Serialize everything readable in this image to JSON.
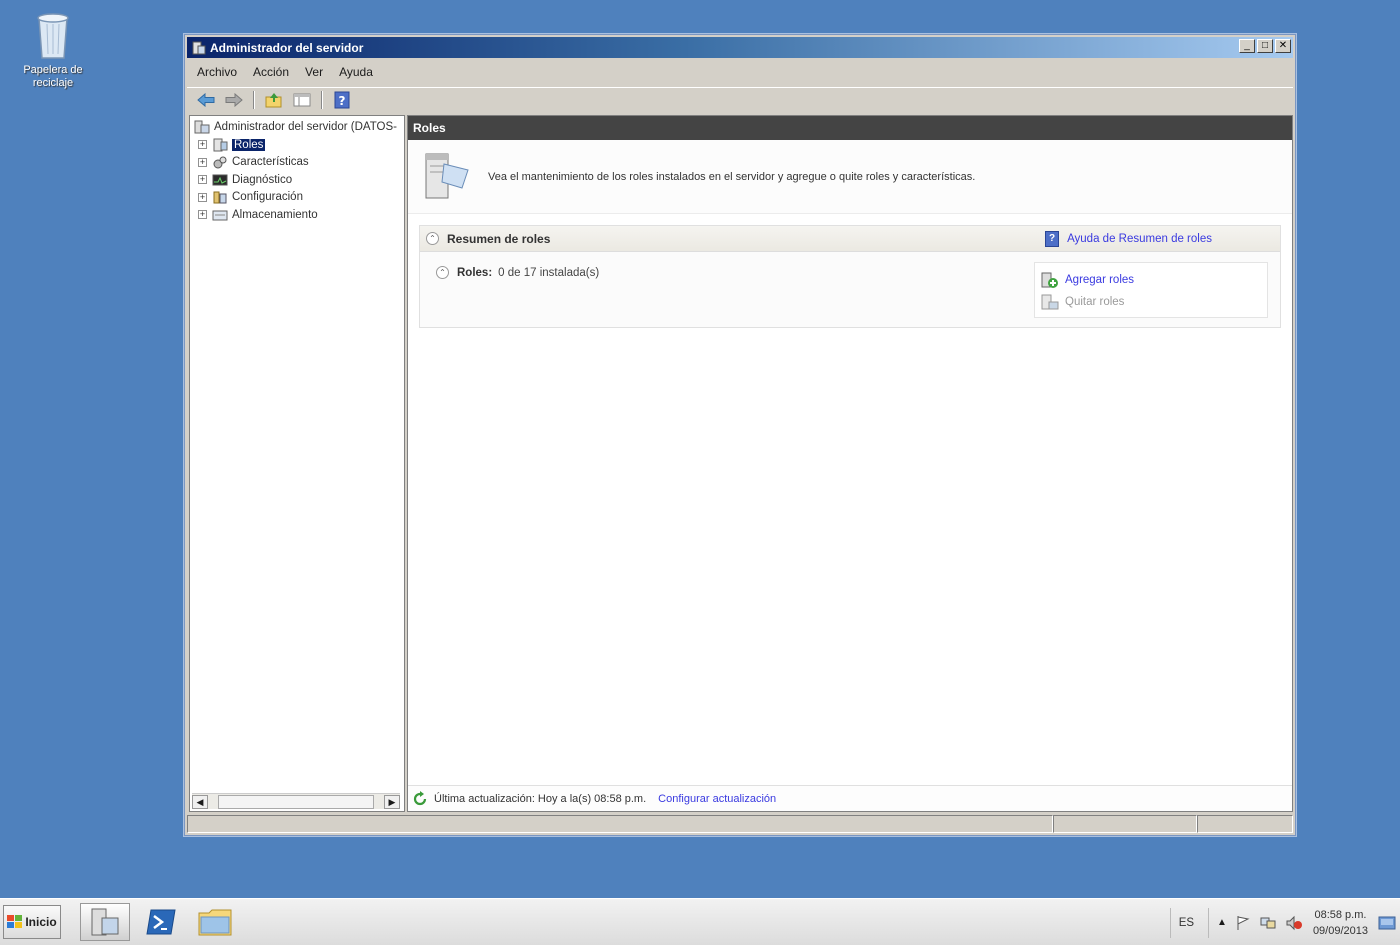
{
  "desktop": {
    "recycle_bin_label": "Papelera de reciclaje"
  },
  "window": {
    "title": "Administrador del servidor",
    "controls": {
      "minimize": "_",
      "maximize": "□",
      "close": "✕"
    },
    "menu": [
      "Archivo",
      "Acción",
      "Ver",
      "Ayuda"
    ],
    "toolbar_icons": [
      "back-arrow-icon",
      "forward-arrow-icon",
      "up-folder-icon",
      "show-hide-console-tree-icon",
      "help-icon"
    ]
  },
  "tree": {
    "root": "Administrador del servidor (DATOS-",
    "items": [
      {
        "label": "Roles",
        "icon": "roles-icon",
        "selected": true
      },
      {
        "label": "Características",
        "icon": "features-icon"
      },
      {
        "label": "Diagnóstico",
        "icon": "diagnostics-icon"
      },
      {
        "label": "Configuración",
        "icon": "configuration-icon"
      },
      {
        "label": "Almacenamiento",
        "icon": "storage-icon"
      }
    ],
    "expander_glyph": "+"
  },
  "main": {
    "header": "Roles",
    "description": "Vea el mantenimiento de los roles instalados en el servidor y agregue o quite roles y características.",
    "summary": {
      "title": "Resumen de roles",
      "help_link": "Ayuda de Resumen de roles",
      "roles_label": "Roles:",
      "roles_value": "0 de 17 instalada(s)",
      "actions": {
        "add": "Agregar roles",
        "remove": "Quitar roles"
      }
    },
    "footer": {
      "last_update": "Última actualización: Hoy a la(s) 08:58 p.m.",
      "configure_link": "Configurar actualización"
    }
  },
  "taskbar": {
    "start_label": "Inicio",
    "language": "ES",
    "time": "08:58 p.m.",
    "date": "09/09/2013"
  }
}
